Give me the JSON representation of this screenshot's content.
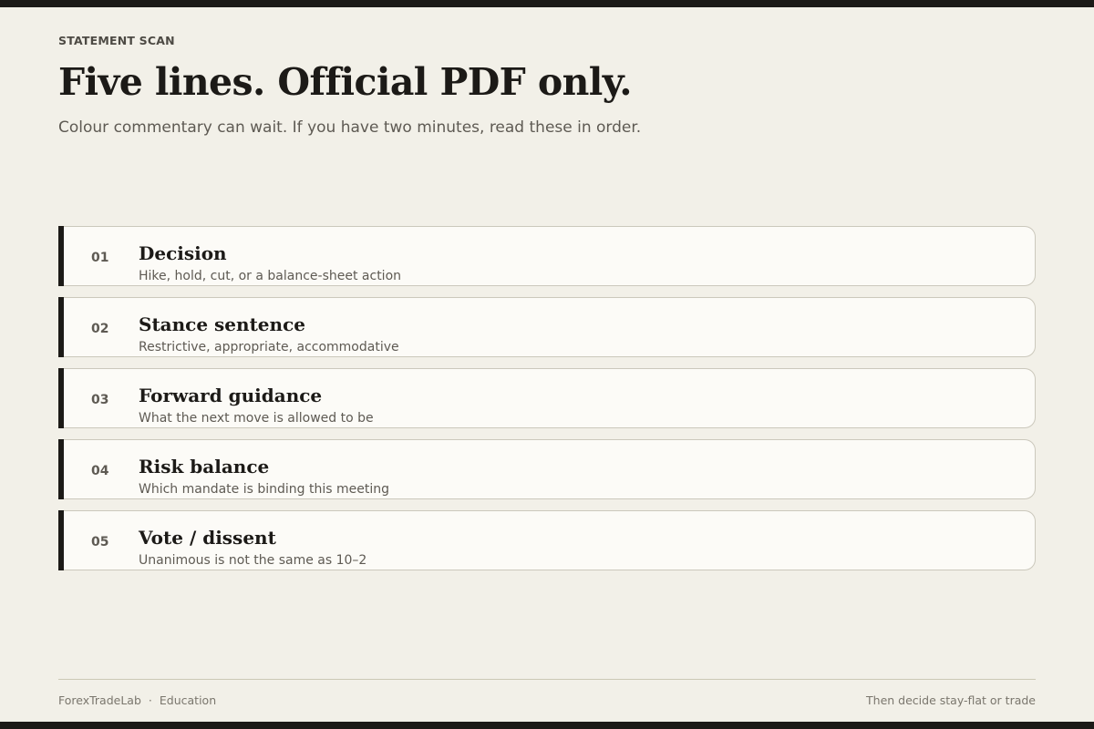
{
  "eyebrow": "STATEMENT SCAN",
  "headline": "Five lines. Official PDF only.",
  "subhead": "Colour commentary can wait. If you have two minutes, read these in order.",
  "items": [
    {
      "num": "01",
      "title": "Decision",
      "desc": "Hike, hold, cut, or a balance-sheet action"
    },
    {
      "num": "02",
      "title": "Stance sentence",
      "desc": "Restrictive, appropriate, accommodative"
    },
    {
      "num": "03",
      "title": "Forward guidance",
      "desc": "What the next move is allowed to be"
    },
    {
      "num": "04",
      "title": "Risk balance",
      "desc": "Which mandate is binding this meeting"
    },
    {
      "num": "05",
      "title": "Vote / dissent",
      "desc": "Unanimous is not the same as 10–2"
    }
  ],
  "footer": {
    "brand": "ForexTradeLab",
    "separator": "·",
    "section": "Education",
    "note": "Then decide stay-flat or trade"
  },
  "colors": {
    "background": "#f2f0e8",
    "card": "#fcfbf7",
    "ink": "#1c1a17",
    "muted": "#5e5a53"
  }
}
